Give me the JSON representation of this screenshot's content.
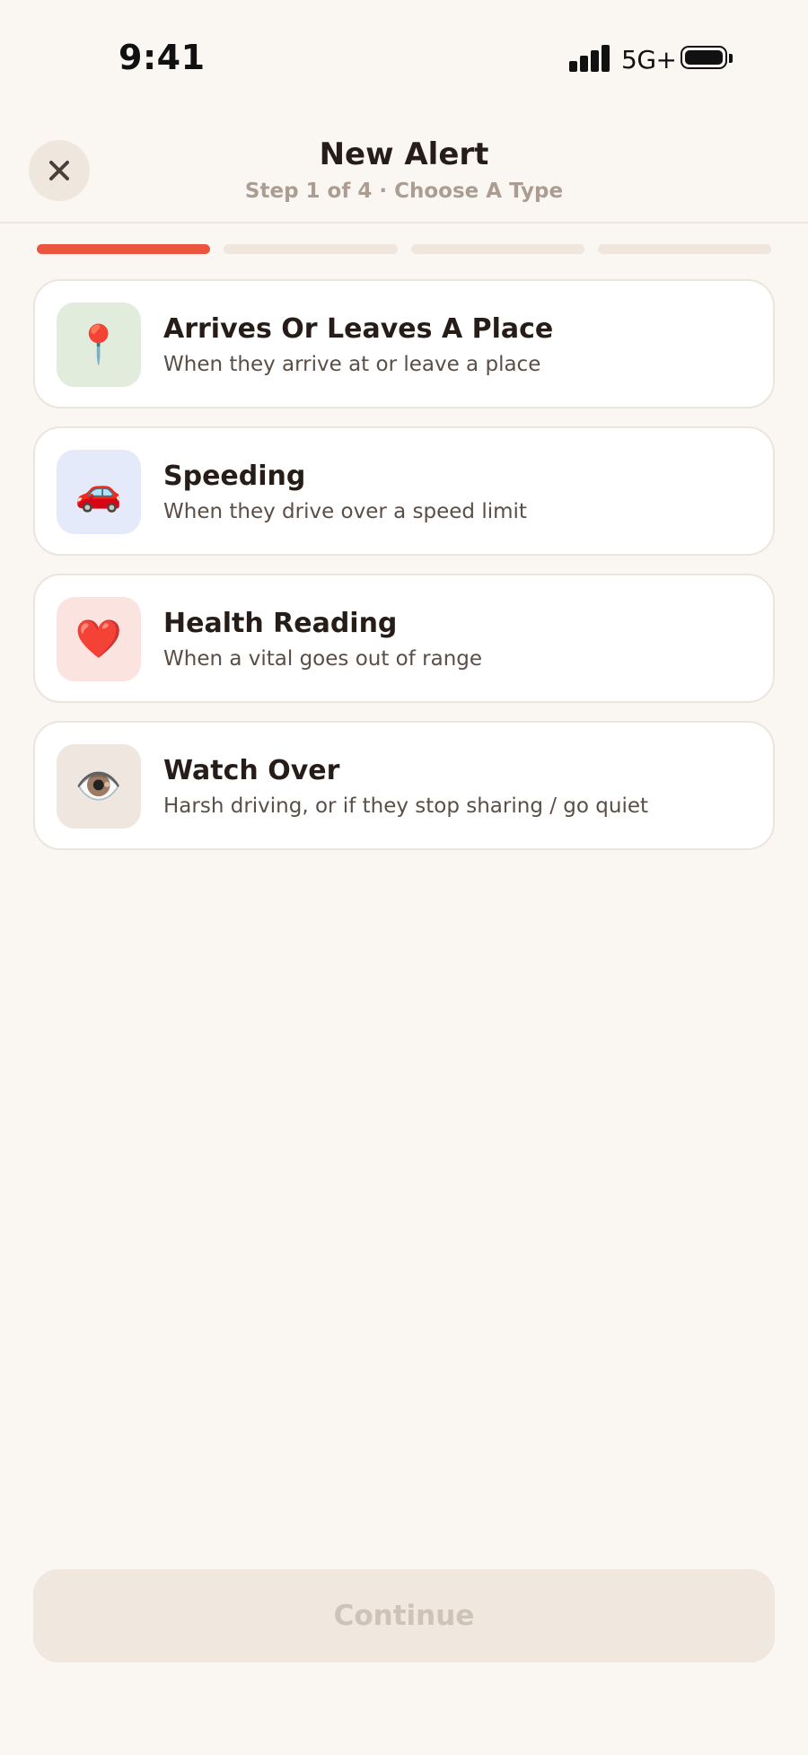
{
  "status_bar": {
    "time": "9:41",
    "network": "5G+"
  },
  "header": {
    "title": "New Alert",
    "subtitle": "Step 1 of 4 · Choose A Type",
    "close_icon": "close-icon"
  },
  "progress": {
    "current_step": 1,
    "total_steps": 4,
    "accent_color": "#ea5540"
  },
  "options": [
    {
      "title": "Arrives Or Leaves A Place",
      "description": "When they arrive at or leave a place",
      "icon": "📍",
      "icon_name": "map-pin-icon",
      "icon_bg": "#e2ecdd"
    },
    {
      "title": "Speeding",
      "description": "When they drive over a speed limit",
      "icon": "🚗",
      "icon_name": "car-icon",
      "icon_bg": "#e5eafa"
    },
    {
      "title": "Health Reading",
      "description": "When a vital goes out of range",
      "icon": "❤️",
      "icon_name": "heart-icon",
      "icon_bg": "#fbe3e0"
    },
    {
      "title": "Watch Over",
      "description": "Harsh driving, or if they stop sharing / go quiet",
      "icon": "👁️",
      "icon_name": "eye-icon",
      "icon_bg": "#efe7df"
    }
  ],
  "footer": {
    "continue_label": "Continue",
    "continue_enabled": false
  }
}
